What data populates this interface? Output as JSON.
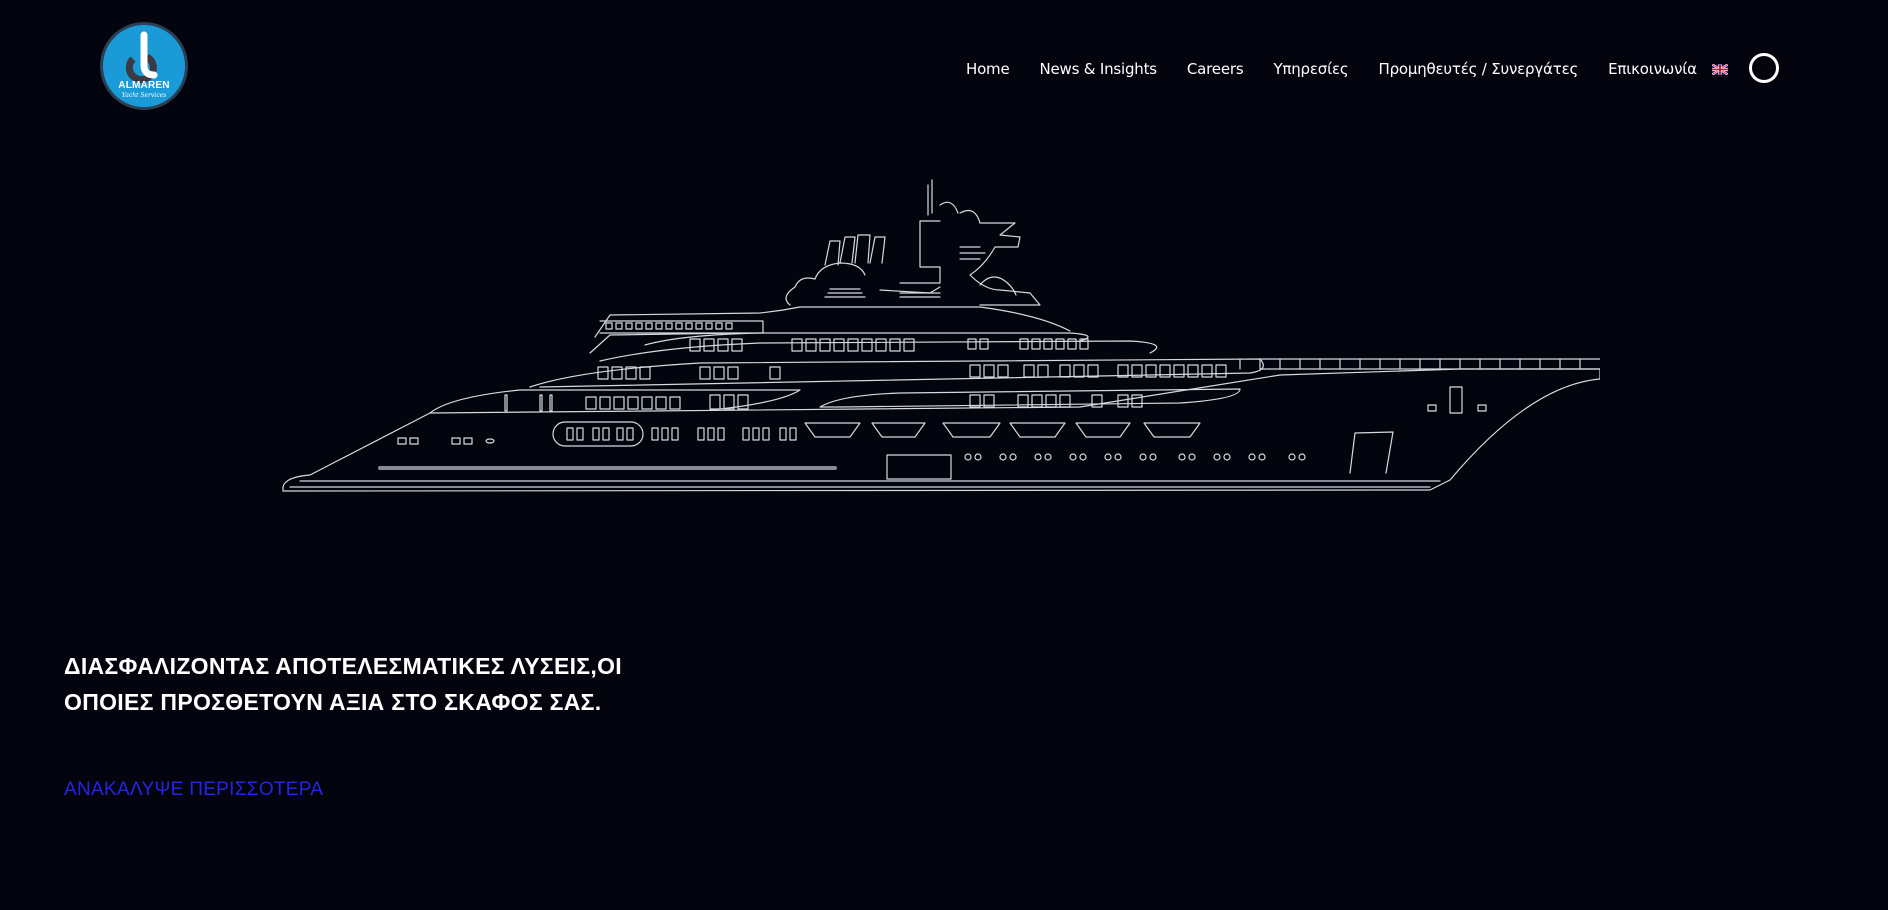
{
  "brand": {
    "name": "ALMAREN",
    "tagline": "Yacht Services",
    "logo_color": "#1a9bd7"
  },
  "nav": {
    "items": [
      {
        "label": "Home"
      },
      {
        "label": "News & Insights"
      },
      {
        "label": "Careers"
      },
      {
        "label": "Υπηρεσίες"
      },
      {
        "label": "Προμηθευτές / Συνεργάτες"
      },
      {
        "label": "Επικοινωνία"
      }
    ],
    "language_icon": "uk-flag-icon",
    "search_icon": "search-circle-icon"
  },
  "hero": {
    "headline": "ΔΙΑΣΦΑΛΙΖΟΝΤΑΣ ΑΠΟΤΕΛΕΣΜΑΤΙΚΕΣ ΛΥΣΕΙΣ,ΟΙ ΟΠΟΙΕΣ ΠΡΟΣΘΕΤΟΥΝ ΑΞΙΑ ΣΤΟ ΣΚΑΦΟΣ ΣΑΣ.",
    "cta_label": "ΑΝΑΚΑΛΥΨΕ ΠΕΡΙΣΣΟΤΕΡΑ",
    "cta_color": "#2424e8",
    "image": "yacht-outline-drawing"
  },
  "colors": {
    "background": "#04040f",
    "text": "#ffffff",
    "line_art": "#d8d8e0"
  }
}
